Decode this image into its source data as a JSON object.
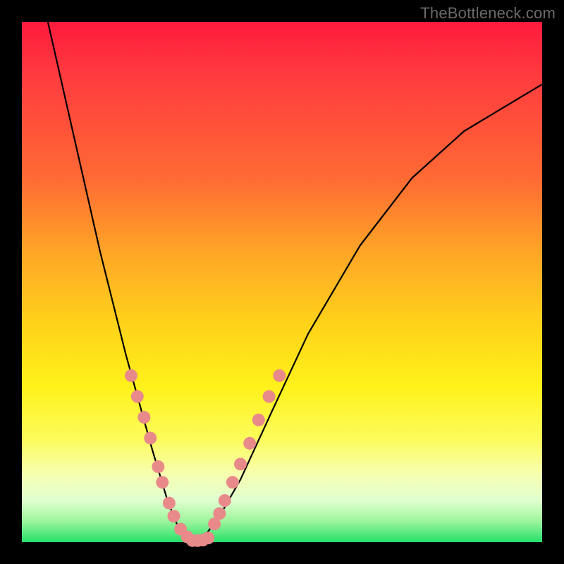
{
  "watermark": "TheBottleneck.com",
  "colors": {
    "dot": "#e98a8a",
    "curve": "#000000"
  },
  "chart_data": {
    "type": "line",
    "title": "",
    "xlabel": "",
    "ylabel": "",
    "xlim": [
      0,
      100
    ],
    "ylim": [
      0,
      100
    ],
    "description": "V-shaped bottleneck curve on rainbow gradient; y is mismatch percentage (0 at bottom/green, 100 at top/red); minimum near x≈33 where y≈0",
    "series": [
      {
        "name": "curve",
        "x": [
          5,
          10,
          15,
          20,
          25,
          28,
          30,
          32,
          33,
          35,
          38,
          42,
          48,
          55,
          65,
          75,
          85,
          95,
          100
        ],
        "y": [
          100,
          78,
          56,
          36,
          18,
          8,
          3,
          1,
          0,
          1,
          5,
          12,
          25,
          40,
          57,
          70,
          79,
          85,
          88
        ]
      }
    ],
    "dots_left": [
      {
        "x": 21.0,
        "y": 32.0
      },
      {
        "x": 22.2,
        "y": 28.0
      },
      {
        "x": 23.5,
        "y": 24.0
      },
      {
        "x": 24.7,
        "y": 20.0
      },
      {
        "x": 26.2,
        "y": 14.5
      },
      {
        "x": 27.0,
        "y": 11.5
      },
      {
        "x": 28.3,
        "y": 7.5
      },
      {
        "x": 29.2,
        "y": 5.0
      },
      {
        "x": 30.5,
        "y": 2.5
      },
      {
        "x": 31.8,
        "y": 1.0
      }
    ],
    "dots_bottom": [
      {
        "x": 32.8,
        "y": 0.3
      },
      {
        "x": 33.8,
        "y": 0.3
      },
      {
        "x": 34.8,
        "y": 0.4
      },
      {
        "x": 35.8,
        "y": 0.8
      }
    ],
    "dots_right": [
      {
        "x": 37.0,
        "y": 3.5
      },
      {
        "x": 38.0,
        "y": 5.5
      },
      {
        "x": 39.0,
        "y": 8.0
      },
      {
        "x": 40.5,
        "y": 11.5
      },
      {
        "x": 42.0,
        "y": 15.0
      },
      {
        "x": 43.8,
        "y": 19.0
      },
      {
        "x": 45.5,
        "y": 23.5
      },
      {
        "x": 47.5,
        "y": 28.0
      },
      {
        "x": 49.5,
        "y": 32.0
      }
    ],
    "dot_radius": 9
  }
}
